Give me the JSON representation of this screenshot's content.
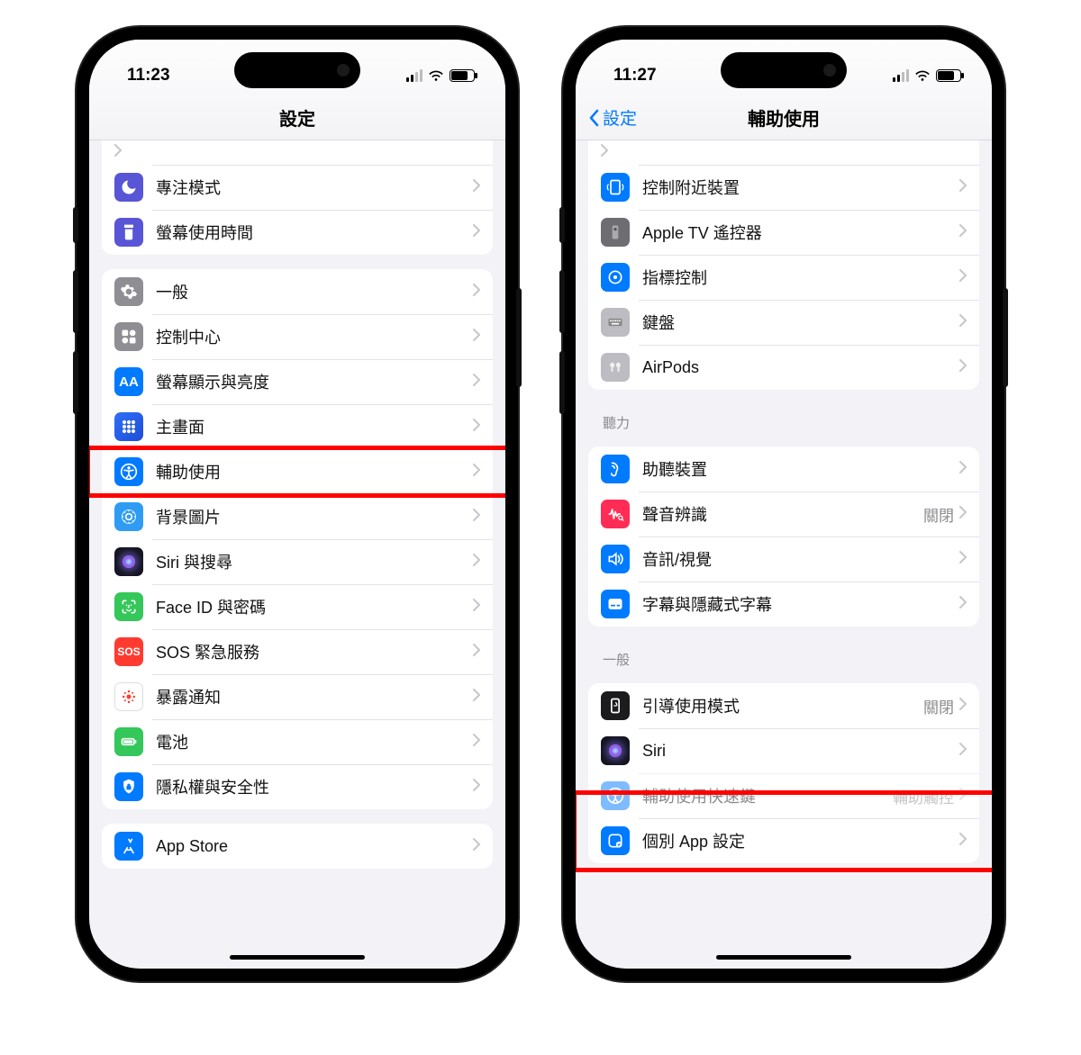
{
  "left": {
    "time": "11:23",
    "title": "設定",
    "groups": [
      {
        "partial": true,
        "rows": [
          {
            "icon": "focus-icon",
            "iconClass": "bg-purple",
            "label": "專注模式"
          },
          {
            "icon": "screentime-icon",
            "iconClass": "bg-purple",
            "label": "螢幕使用時間"
          }
        ]
      },
      {
        "rows": [
          {
            "icon": "general-icon",
            "iconClass": "bg-grey",
            "label": "一般"
          },
          {
            "icon": "control-center-icon",
            "iconClass": "bg-grey",
            "label": "控制中心"
          },
          {
            "icon": "display-icon",
            "iconClass": "bg-blue",
            "label": "螢幕顯示與亮度"
          },
          {
            "icon": "home-screen-icon",
            "iconClass": "bg-apps",
            "label": "主畫面"
          },
          {
            "icon": "accessibility-icon",
            "iconClass": "bg-blue",
            "label": "輔助使用",
            "highlight": true
          },
          {
            "icon": "wallpaper-icon",
            "iconClass": "bg-teal",
            "label": "背景圖片"
          },
          {
            "icon": "siri-icon",
            "iconClass": "",
            "label": "Siri 與搜尋",
            "siri": true
          },
          {
            "icon": "faceid-icon",
            "iconClass": "bg-green",
            "label": "Face ID 與密碼"
          },
          {
            "icon": "sos-icon",
            "iconClass": "bg-red",
            "label": "SOS 緊急服務",
            "text": "SOS"
          },
          {
            "icon": "exposure-icon",
            "iconClass": "bg-white",
            "label": "暴露通知",
            "redStar": true
          },
          {
            "icon": "battery-icon",
            "iconClass": "bg-green",
            "label": "電池"
          },
          {
            "icon": "privacy-icon",
            "iconClass": "bg-blue",
            "label": "隱私權與安全性"
          }
        ]
      },
      {
        "rows": [
          {
            "icon": "appstore-icon",
            "iconClass": "bg-blue",
            "label": "App Store"
          }
        ]
      }
    ]
  },
  "right": {
    "time": "11:27",
    "back": "設定",
    "title": "輔助使用",
    "groups": [
      {
        "partial": true,
        "rows": [
          {
            "icon": "nearby-icon",
            "iconClass": "bg-blue",
            "label": "控制附近裝置"
          },
          {
            "icon": "appletv-icon",
            "iconClass": "bg-dgrey",
            "label": "Apple TV 遙控器"
          },
          {
            "icon": "pointer-icon",
            "iconClass": "bg-blue",
            "label": "指標控制"
          },
          {
            "icon": "keyboard-icon",
            "iconClass": "bg-lgrey",
            "label": "鍵盤"
          },
          {
            "icon": "airpods-icon",
            "iconClass": "bg-lgrey",
            "label": "AirPods"
          }
        ]
      },
      {
        "header": "聽力",
        "rows": [
          {
            "icon": "hearing-icon",
            "iconClass": "bg-blue",
            "label": "助聽裝置"
          },
          {
            "icon": "sound-recog-icon",
            "iconClass": "bg-pink",
            "label": "聲音辨識",
            "value": "關閉"
          },
          {
            "icon": "audio-visual-icon",
            "iconClass": "bg-blue",
            "label": "音訊/視覺"
          },
          {
            "icon": "subtitles-icon",
            "iconClass": "bg-blue",
            "label": "字幕與隱藏式字幕"
          }
        ]
      },
      {
        "header": "一般",
        "rows": [
          {
            "icon": "guided-icon",
            "iconClass": "bg-black",
            "label": "引導使用模式",
            "value": "關閉"
          },
          {
            "icon": "siri-icon",
            "iconClass": "",
            "label": "Siri",
            "siri": true
          },
          {
            "icon": "shortcut-icon",
            "iconClass": "bg-blue",
            "label": "輔助使用快速鍵",
            "value": "輔助觸控",
            "dim": true
          },
          {
            "icon": "perapp-icon",
            "iconClass": "bg-blue",
            "label": "個別 App 設定",
            "highlight": true
          }
        ]
      }
    ]
  }
}
